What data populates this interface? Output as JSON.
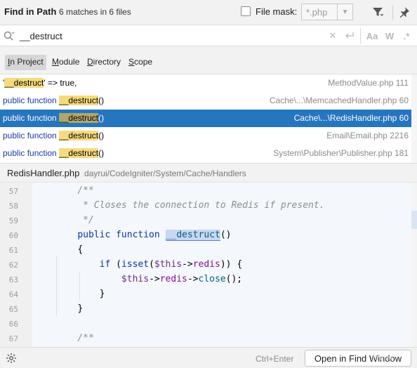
{
  "header": {
    "title": "Find in Path",
    "matches": "6 matches in 6 files",
    "file_mask_label": "File mask:",
    "file_mask_value": "*.php"
  },
  "search": {
    "query": "__destruct",
    "options": {
      "match_case": "Aa",
      "words": "W",
      "regex": ".*"
    }
  },
  "scopes": [
    {
      "before": "",
      "mnemonic": "I",
      "after": "n Project",
      "active": true
    },
    {
      "before": "",
      "mnemonic": "M",
      "after": "odule",
      "active": false
    },
    {
      "before": "",
      "mnemonic": "D",
      "after": "irectory",
      "active": false
    },
    {
      "before": "",
      "mnemonic": "S",
      "after": "cope",
      "active": false
    }
  ],
  "results": [
    {
      "pre": "'",
      "keyword": "",
      "match": "__destruct",
      "post": "' => true,",
      "file": "MethodValue.php 111",
      "selected": false
    },
    {
      "pre": "",
      "keyword": "public function ",
      "match": "__destruct",
      "post": "()",
      "file": "Cache\\...\\MemcachedHandler.php 60",
      "selected": false
    },
    {
      "pre": "",
      "keyword": "public function ",
      "match": "__destruct",
      "post": "()",
      "file": "Cache\\...\\RedisHandler.php 60",
      "selected": true
    },
    {
      "pre": "",
      "keyword": "public function ",
      "match": "__destruct",
      "post": "()",
      "file": "Email\\Email.php 2216",
      "selected": false
    },
    {
      "pre": "",
      "keyword": "public function ",
      "match": "__destruct",
      "post": "()",
      "file": "System\\Publisher\\Publisher.php 181",
      "selected": false
    }
  ],
  "preview": {
    "file": "RedisHandler.php",
    "path": "dayrui/CodeIgniter/System/Cache/Handlers",
    "lines": [
      {
        "n": "57",
        "indent": "    ",
        "parts": [
          {
            "t": "/**",
            "c": "cm"
          }
        ]
      },
      {
        "n": "58",
        "indent": "     ",
        "parts": [
          {
            "t": "* Closes the connection to Redis if present.",
            "c": "cm"
          }
        ]
      },
      {
        "n": "59",
        "indent": "     ",
        "parts": [
          {
            "t": "*/",
            "c": "cm"
          }
        ]
      },
      {
        "n": "60",
        "indent": "    ",
        "parts": [
          {
            "t": "public function ",
            "c": "kw"
          },
          {
            "t": "__destruct",
            "c": "match"
          },
          {
            "t": "()",
            "c": ""
          }
        ]
      },
      {
        "n": "61",
        "indent": "    ",
        "parts": [
          {
            "t": "{",
            "c": ""
          }
        ]
      },
      {
        "n": "62",
        "indent": "        ",
        "parts": [
          {
            "t": "if ",
            "c": "kw"
          },
          {
            "t": "(",
            "c": ""
          },
          {
            "t": "isset",
            "c": "kw"
          },
          {
            "t": "(",
            "c": ""
          },
          {
            "t": "$this",
            "c": "var"
          },
          {
            "t": "->",
            "c": ""
          },
          {
            "t": "redis",
            "c": "prop"
          },
          {
            "t": ")) {",
            "c": ""
          }
        ]
      },
      {
        "n": "63",
        "indent": "            ",
        "parts": [
          {
            "t": "$this",
            "c": "var"
          },
          {
            "t": "->",
            "c": ""
          },
          {
            "t": "redis",
            "c": "prop"
          },
          {
            "t": "->",
            "c": ""
          },
          {
            "t": "close",
            "c": "fn"
          },
          {
            "t": "();",
            "c": ""
          }
        ]
      },
      {
        "n": "64",
        "indent": "        ",
        "parts": [
          {
            "t": "}",
            "c": ""
          }
        ]
      },
      {
        "n": "65",
        "indent": "    ",
        "parts": [
          {
            "t": "}",
            "c": ""
          }
        ]
      },
      {
        "n": "66",
        "indent": "",
        "parts": []
      },
      {
        "n": "67",
        "indent": "    ",
        "parts": [
          {
            "t": "/**",
            "c": "cm"
          }
        ]
      }
    ]
  },
  "footer": {
    "shortcut": "Ctrl+Enter",
    "open_button": "Open in Find Window",
    "watermark": "dayr4y"
  },
  "colors": {
    "selection": "#2675bf",
    "match_highlight": "#f7da7d",
    "keyword": "#0b33a8"
  }
}
